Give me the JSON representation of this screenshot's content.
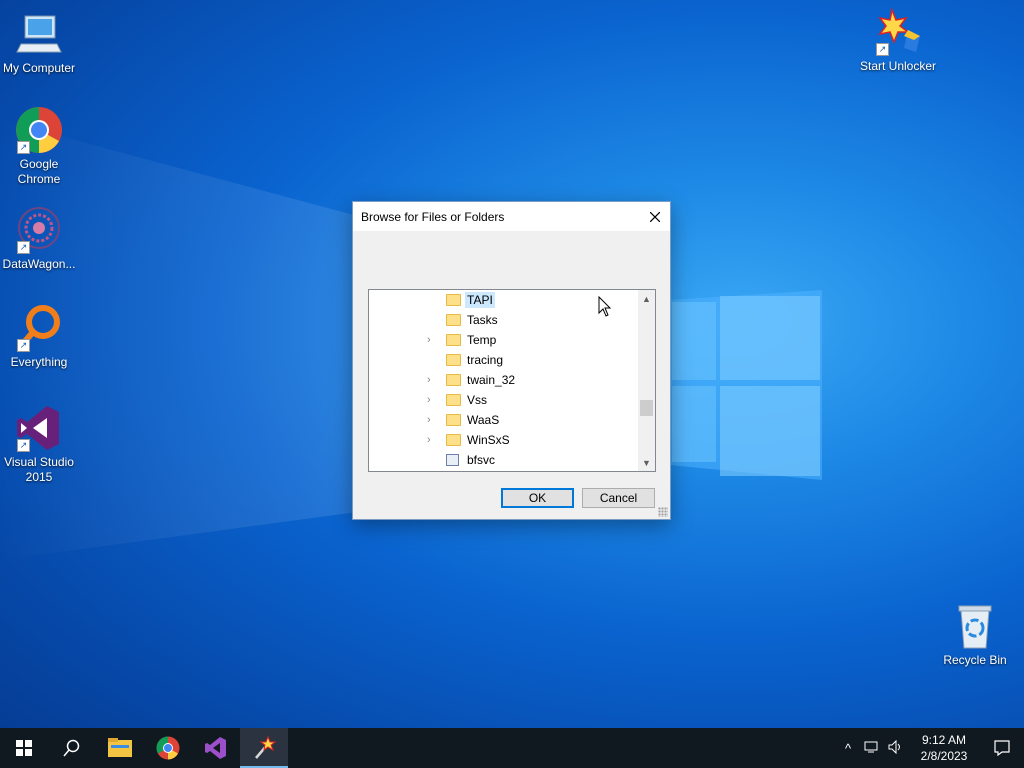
{
  "desktop": {
    "icons_left": [
      {
        "label": "My Computer"
      },
      {
        "label": "Google Chrome"
      },
      {
        "label": "DataWagon..."
      },
      {
        "label": "Everything"
      },
      {
        "label": "Visual Studio 2015"
      }
    ],
    "icon_start_unlocker": "Start Unlocker",
    "icon_recycle_bin": "Recycle Bin"
  },
  "dialog": {
    "title": "Browse for Files or Folders",
    "tree_items": [
      {
        "label": "TAPI",
        "type": "folder",
        "expandable": false,
        "selected": true
      },
      {
        "label": "Tasks",
        "type": "folder",
        "expandable": false
      },
      {
        "label": "Temp",
        "type": "folder",
        "expandable": true
      },
      {
        "label": "tracing",
        "type": "folder",
        "expandable": false
      },
      {
        "label": "twain_32",
        "type": "folder",
        "expandable": true
      },
      {
        "label": "Vss",
        "type": "folder",
        "expandable": true
      },
      {
        "label": "WaaS",
        "type": "folder",
        "expandable": true
      },
      {
        "label": "WinSxS",
        "type": "folder",
        "expandable": true
      },
      {
        "label": "bfsvc",
        "type": "file",
        "expandable": false
      }
    ],
    "ok_label": "OK",
    "cancel_label": "Cancel"
  },
  "taskbar": {
    "time": "9:12 AM",
    "date": "2/8/2023",
    "pinned": [
      "start-icon",
      "search-icon",
      "file-explorer-icon",
      "chrome-icon",
      "visual-studio-icon",
      "start-unlocker-icon"
    ]
  },
  "colors": {
    "accent": "#0078d7",
    "selection": "#cce8ff",
    "taskbar": "#101820"
  }
}
